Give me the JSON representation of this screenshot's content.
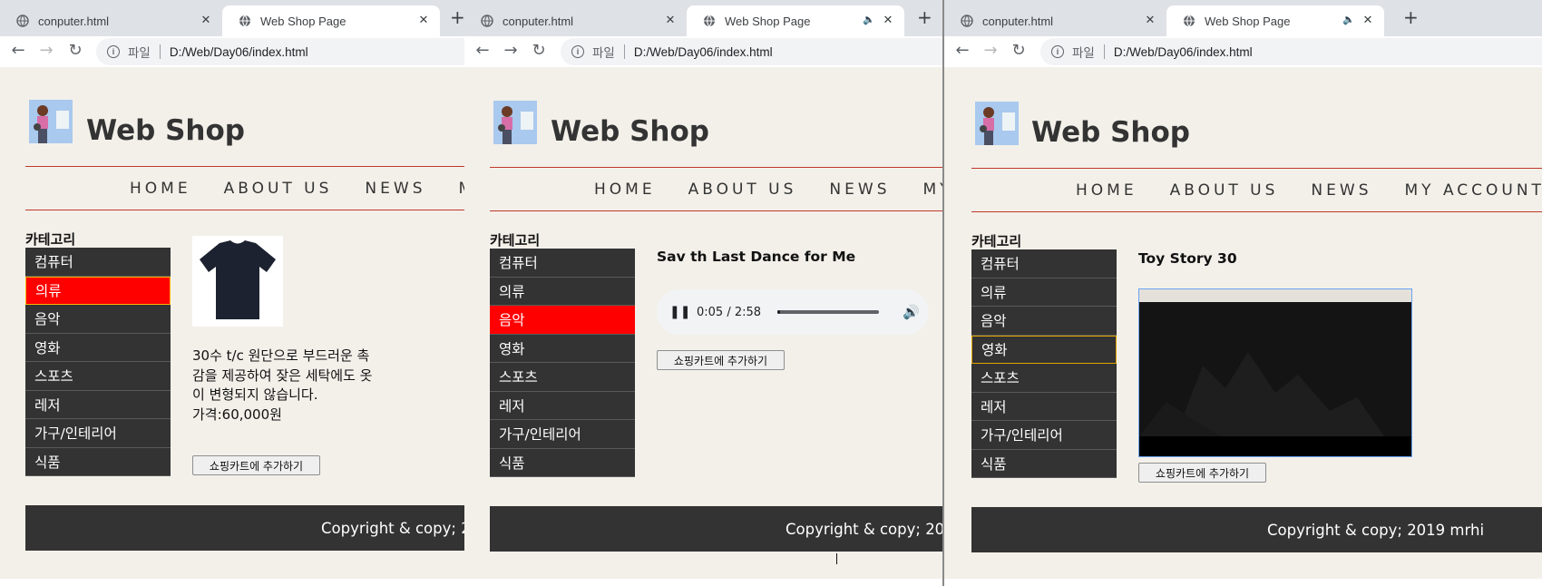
{
  "browser": {
    "tabs": {
      "inactive_title": "conputer.html",
      "active_title": "Web Shop Page",
      "close_glyph": "✕",
      "new_tab_glyph": "+"
    },
    "url_scheme": "파일",
    "url": "D:/Web/Day06/index.html",
    "icons": [
      "globe-icon",
      "speaker-icon",
      "back-icon",
      "forward-icon",
      "reload-icon",
      "info-icon"
    ]
  },
  "site": {
    "title": "Web Shop",
    "menu": [
      "HOME",
      "ABOUT US",
      "NEWS",
      "MY ACCOUNT"
    ],
    "category_heading": "카테고리",
    "categories": [
      "컴퓨터",
      "의류",
      "음악",
      "영화",
      "스포츠",
      "레저",
      "가구/인테리어",
      "식품"
    ],
    "cart_button": "쇼핑카트에 추가하기",
    "footer": "Copyright & copy; 2019 mrhi"
  },
  "panels": {
    "clothing": {
      "selected_category": "의류",
      "description": "30수 t/c 원단으로 부드러운 촉감을 제공하여 잦은 세탁에도 옷이 변형되지 않습니다.",
      "price": "가격:60,000원",
      "image": "t-shirt-image"
    },
    "music": {
      "selected_category": "음악",
      "product_title": "Sav th Last Dance for Me",
      "audio_time": "0:05 / 2:58",
      "audio_progress_fraction": 0.03
    },
    "movie": {
      "selected_category": "영화",
      "product_title": "Toy Story 30"
    }
  },
  "colors": {
    "page_bg": "#f3f0ea",
    "category_bg": "#333333",
    "selected_bg": "#ff0000",
    "rule": "#c0392b",
    "footer_bg": "#333333"
  }
}
